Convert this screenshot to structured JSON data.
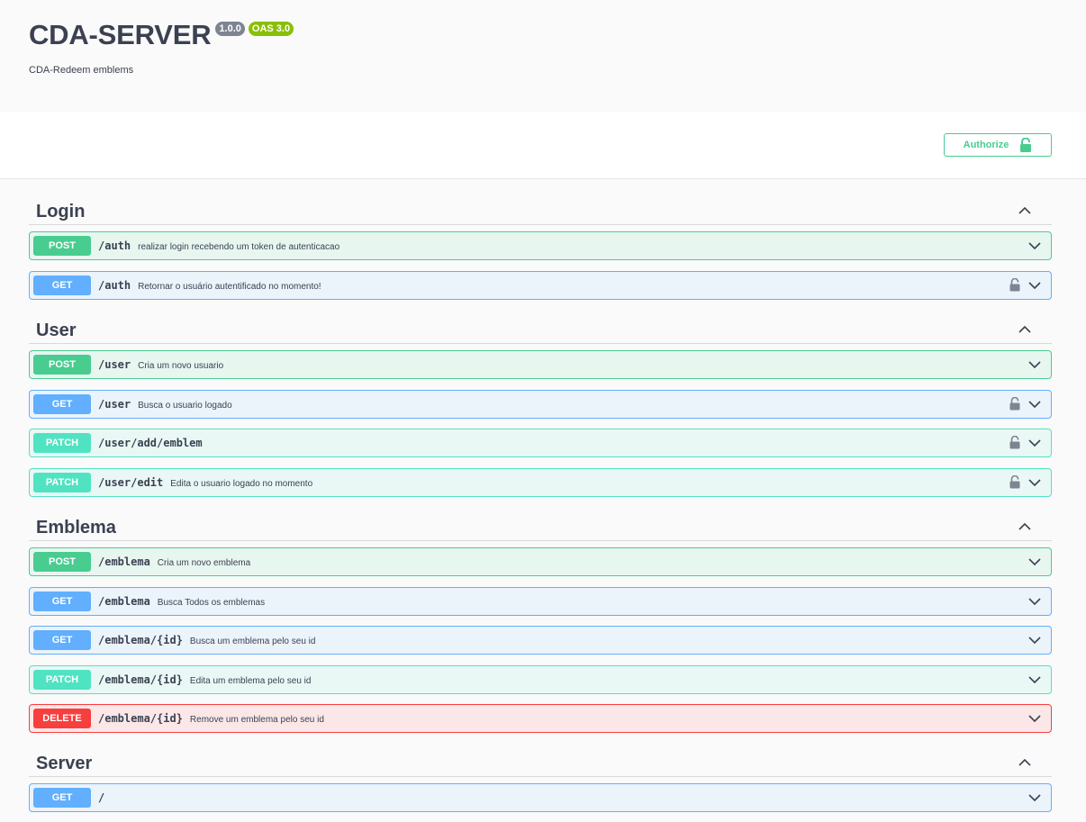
{
  "info": {
    "title": "CDA-SERVER",
    "version": "1.0.0",
    "oas": "OAS 3.0",
    "description": "CDA-Redeem emblems"
  },
  "scheme": {
    "authorize_label": "Authorize",
    "authorize_icon": "lock-open-icon"
  },
  "colors": {
    "post": "#49cc90",
    "get": "#61affe",
    "patch": "#50e3c2",
    "delete": "#f93e3e"
  },
  "tags": [
    {
      "name": "Login",
      "operations": [
        {
          "method": "POST",
          "path": "/auth",
          "summary": "realizar login recebendo um token de autenticacao",
          "locked": false
        },
        {
          "method": "GET",
          "path": "/auth",
          "summary": "Retornar o usuário autentificado no momento!",
          "locked": true
        }
      ]
    },
    {
      "name": "User",
      "operations": [
        {
          "method": "POST",
          "path": "/user",
          "summary": "Cria um novo usuario",
          "locked": false
        },
        {
          "method": "GET",
          "path": "/user",
          "summary": "Busca o usuario logado",
          "locked": true
        },
        {
          "method": "PATCH",
          "path": "/user/add/emblem",
          "summary": "",
          "locked": true
        },
        {
          "method": "PATCH",
          "path": "/user/edit",
          "summary": "Edita o usuario logado no momento",
          "locked": true
        }
      ]
    },
    {
      "name": "Emblema",
      "operations": [
        {
          "method": "POST",
          "path": "/emblema",
          "summary": "Cria um novo emblema",
          "locked": false
        },
        {
          "method": "GET",
          "path": "/emblema",
          "summary": "Busca Todos os emblemas",
          "locked": false
        },
        {
          "method": "GET",
          "path": "/emblema/{id}",
          "summary": "Busca um emblema pelo seu id",
          "locked": false
        },
        {
          "method": "PATCH",
          "path": "/emblema/{id}",
          "summary": "Edita um emblema pelo seu id",
          "locked": false
        },
        {
          "method": "DELETE",
          "path": "/emblema/{id}",
          "summary": "Remove um emblema pelo seu id",
          "locked": false
        }
      ]
    },
    {
      "name": "Server",
      "operations": [
        {
          "method": "GET",
          "path": "/",
          "summary": "",
          "locked": false
        }
      ]
    }
  ]
}
